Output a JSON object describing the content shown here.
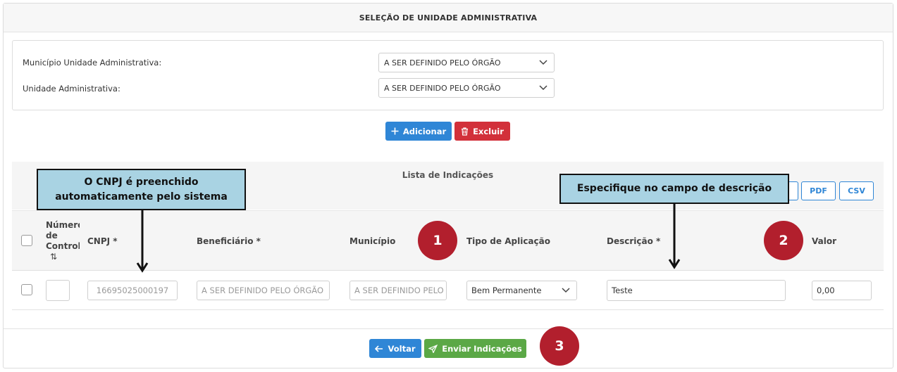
{
  "section": {
    "title": "SELEÇÃO DE UNIDADE ADMINISTRATIVA"
  },
  "form": {
    "municipio_label": "Município Unidade Administrativa:",
    "municipio_value": "A SER DEFINIDO PELO ÓRGÃO",
    "unidade_label": "Unidade Administrativa:",
    "unidade_value": "A SER DEFINIDO PELO ÓRGÃO"
  },
  "actions": {
    "add_label": "Adicionar",
    "delete_label": "Excluir"
  },
  "list": {
    "title": "Lista de Indicações",
    "export": {
      "pdf": "PDF",
      "csv": "CSV"
    },
    "columns": {
      "numero_l1": "Número",
      "numero_l2": "de",
      "numero_l3": "Controle",
      "sort_icon": "⇅",
      "cnpj": "CNPJ *",
      "beneficiario": "Beneficiário *",
      "municipio": "Município",
      "tipo": "Tipo de Aplicação",
      "descricao": "Descrição *",
      "valor": "Valor"
    },
    "rows": [
      {
        "numero": "",
        "cnpj": "16695025000197",
        "beneficiario": "A SER DEFINIDO PELO ÓRGÃO",
        "municipio": "A SER DEFINIDO PELO ÓRGÃO",
        "tipo": "Bem Permanente",
        "descricao": "Teste",
        "valor": "0,00"
      }
    ]
  },
  "footer": {
    "back_label": "Voltar",
    "send_label": "Enviar Indicações"
  },
  "annotations": {
    "cnpj_note_l1": "O CNPJ é preenchido",
    "cnpj_note_l2": "automaticamente pelo sistema",
    "desc_note": "Especifique no campo de descrição",
    "badge1": "1",
    "badge2": "2",
    "badge3": "3"
  },
  "colors": {
    "primary": "#2f86d6",
    "danger": "#d2303a",
    "success": "#5ba846",
    "badge": "#b21f2d",
    "callout": "#a9d3e3"
  }
}
